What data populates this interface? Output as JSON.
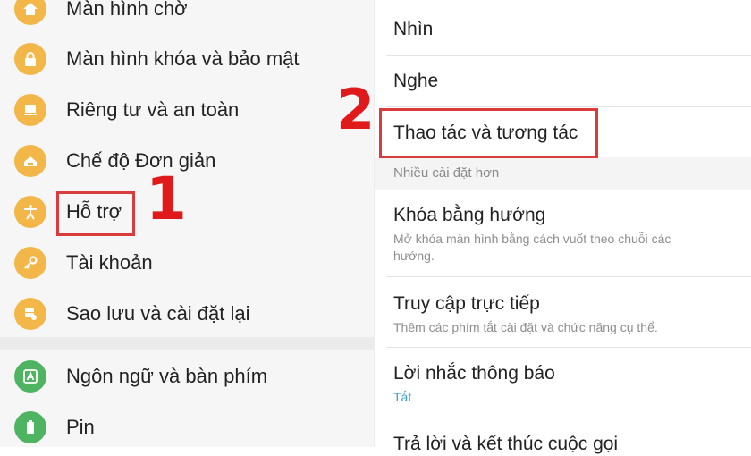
{
  "left_menu": {
    "items": [
      {
        "label": "Màn hình chờ",
        "icon": "home-icon"
      },
      {
        "label": "Màn hình khóa và bảo mật",
        "icon": "lock-icon"
      },
      {
        "label": "Riêng tư và an toàn",
        "icon": "privacy-icon"
      },
      {
        "label": "Chế độ Đơn giản",
        "icon": "easy-mode-icon"
      },
      {
        "label": "Hỗ trợ",
        "icon": "accessibility-icon"
      },
      {
        "label": "Tài khoản",
        "icon": "key-icon"
      },
      {
        "label": "Sao lưu và cài đặt lại",
        "icon": "backup-icon"
      },
      {
        "label": "Ngôn ngữ và bàn phím",
        "icon": "language-icon"
      },
      {
        "label": "Pin",
        "icon": "battery-icon"
      }
    ]
  },
  "right_menu": {
    "items": [
      {
        "title": "Nhìn"
      },
      {
        "title": "Nghe"
      },
      {
        "title": "Thao tác và tương tác"
      }
    ],
    "section_header": "Nhiều cài đặt hơn",
    "more_items": [
      {
        "title": "Khóa bằng hướng",
        "subtitle": "Mở khóa màn hình bằng cách vuốt theo chuỗi các hướng."
      },
      {
        "title": "Truy cập trực tiếp",
        "subtitle": "Thêm các phím tắt cài đặt và chức năng cụ thể."
      },
      {
        "title": "Lời nhắc thông báo",
        "subtitle": "Tắt"
      },
      {
        "title": "Trả lời và kết thúc cuộc gọi"
      }
    ]
  },
  "annotations": {
    "step1": "1",
    "step2": "2"
  },
  "colors": {
    "icon_accent": "#f3b749",
    "highlight_red": "#d93c3c",
    "subtitle_blue": "#3aa0c9"
  }
}
